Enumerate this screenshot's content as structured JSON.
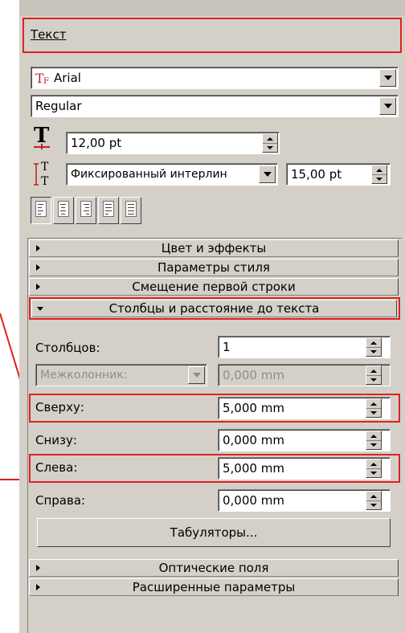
{
  "colors": {
    "panel_bg": "#d4d0c8",
    "highlight": "#e02020",
    "icon_red": "#c0201c"
  },
  "panel": {
    "title": "Текст"
  },
  "font": {
    "family": "Arial",
    "style": "Regular",
    "size": "12,00 pt"
  },
  "leading": {
    "mode": "Фиксированный интерлин",
    "value": "15,00 pt"
  },
  "alignment": {
    "options": [
      "align-left",
      "align-center",
      "align-right",
      "justify",
      "justify-all"
    ],
    "active": 0
  },
  "sections": {
    "color_effects": "Цвет и эффекты",
    "style_params": "Параметры стиля",
    "first_line_indent": "Смещение первой строки",
    "columns_text_distance": "Столбцы и расстояние до текста",
    "optical_margins": "Оптические поля",
    "advanced": "Расширенные параметры"
  },
  "columns": {
    "columns_label": "Столбцов:",
    "columns_value": "1",
    "gutter_label": "Межколонник:",
    "gutter_value": "0,000  mm",
    "top_label": "Сверху:",
    "top_value": "5,000  mm",
    "bottom_label": "Снизу:",
    "bottom_value": "0,000  mm",
    "left_label": "Слева:",
    "left_value": "5,000  mm",
    "right_label": "Справа:",
    "right_value": "0,000  mm",
    "tabs_button": "Табуляторы..."
  }
}
